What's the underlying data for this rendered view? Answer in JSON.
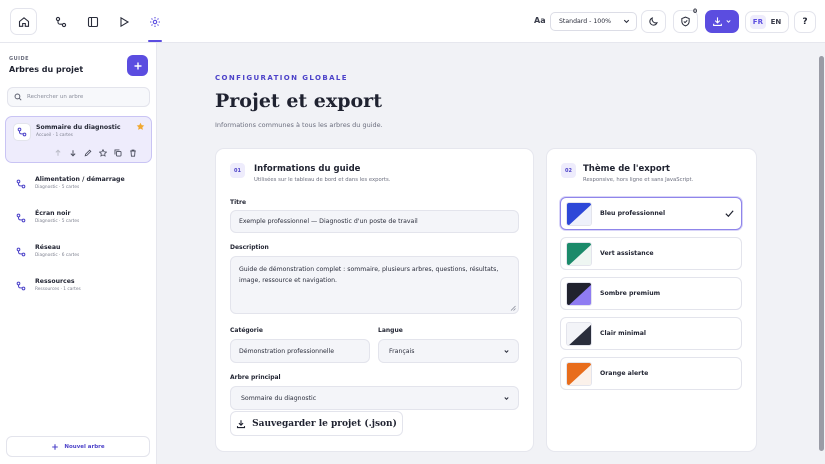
{
  "topbar": {
    "font_label": "Aa",
    "zoom_value": "Standard - 100%",
    "privacy_count": "0",
    "languages": [
      "FR",
      "EN"
    ],
    "active_language": "FR",
    "help_label": "?"
  },
  "sidebar": {
    "eyebrow": "GUIDE",
    "title": "Arbres du projet",
    "search_placeholder": "Rechercher un arbre",
    "trees": [
      {
        "name": "Sommaire du diagnostic",
        "meta": "Accueil · 1 cartes",
        "starred": true,
        "active": true
      },
      {
        "name": "Alimentation / démarrage",
        "meta": "Diagnostic · 5 cartes",
        "starred": false,
        "active": false
      },
      {
        "name": "Écran noir",
        "meta": "Diagnostic · 5 cartes",
        "starred": false,
        "active": false
      },
      {
        "name": "Réseau",
        "meta": "Diagnostic · 6 cartes",
        "starred": false,
        "active": false
      },
      {
        "name": "Ressources",
        "meta": "Ressources · 1 cartes",
        "starred": false,
        "active": false
      }
    ],
    "new_tree_label": "Nouvel arbre"
  },
  "main": {
    "eyebrow": "CONFIGURATION GLOBALE",
    "title": "Projet et export",
    "subtitle": "Informations communes à tous les arbres du guide.",
    "info_card": {
      "step": "01",
      "title": "Informations du guide",
      "subtitle": "Utilisées sur le tableau de bord et dans les exports.",
      "title_label": "Titre",
      "title_value": "Exemple professionnel — Diagnostic d'un poste de travail",
      "description_label": "Description",
      "description_value": "Guide de démonstration complet : sommaire, plusieurs arbres, questions, résultats, image, ressource et navigation.",
      "category_label": "Catégorie",
      "category_value": "Démonstration professionnelle",
      "language_label": "Langue",
      "language_value": "Français",
      "main_tree_label": "Arbre principal",
      "main_tree_value": "Sommaire du diagnostic",
      "save_label": "Sauvegarder le projet (.json)"
    },
    "theme_card": {
      "step": "02",
      "title": "Thème de l'export",
      "subtitle": "Responsive, hors ligne et sans JavaScript.",
      "themes": [
        {
          "name": "Bleu professionnel",
          "colors": [
            "#2d48d8",
            "#eef1fb"
          ],
          "selected": true
        },
        {
          "name": "Vert assistance",
          "colors": [
            "#1b8a6a",
            "#eef6f2"
          ],
          "selected": false
        },
        {
          "name": "Sombre premium",
          "colors": [
            "#8f7cf2",
            "#20222e"
          ],
          "selected": false
        },
        {
          "name": "Clair minimal",
          "colors": [
            "#2a2e3c",
            "#f3f4f8"
          ],
          "selected": false
        },
        {
          "name": "Orange alerte",
          "colors": [
            "#e86d1c",
            "#fbf1ea"
          ],
          "selected": false
        }
      ]
    }
  }
}
